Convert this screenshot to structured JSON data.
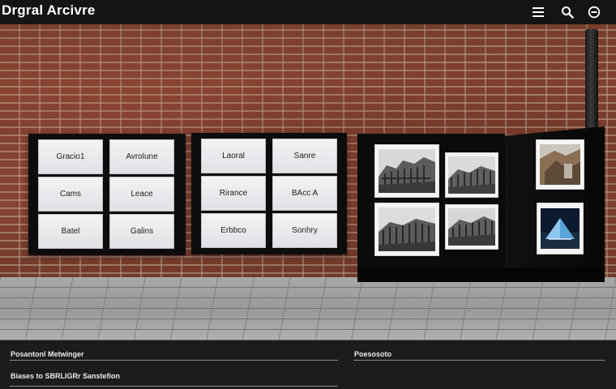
{
  "app": {
    "title": "Drgral Arcivre"
  },
  "topbar": {
    "icons": [
      "menu-icon",
      "search-icon",
      "account-icon"
    ]
  },
  "boards": [
    {
      "tiles": [
        {
          "label": "Gracio1"
        },
        {
          "label": "Avrolune"
        },
        {
          "label": "Cams"
        },
        {
          "label": "Leace"
        },
        {
          "label": "Batel"
        },
        {
          "label": "Galins"
        }
      ]
    },
    {
      "tiles": [
        {
          "label": "Laoral"
        },
        {
          "label": "Sanre"
        },
        {
          "label": "Rirance"
        },
        {
          "label": "BAcc A"
        },
        {
          "label": "Erbbco"
        },
        {
          "label": "Sonhry"
        }
      ]
    }
  ],
  "gallery": {
    "photos": [
      "architecture-photo",
      "architecture-photo",
      "architecture-photo",
      "architecture-photo",
      "landscape-photo",
      "glass-pyramid-photo"
    ]
  },
  "footer": {
    "left_links": [
      "Posantonl Metwinger",
      "Biases to SBRLIGRr Sanstefion"
    ],
    "right_links": [
      "Poesosoto"
    ]
  },
  "colors": {
    "topbar_bg": "#141414",
    "footer_bg": "#1c1c1c",
    "brick": "#7a3e2c",
    "board": "#0d0d0d",
    "tile": "#eceef0"
  }
}
